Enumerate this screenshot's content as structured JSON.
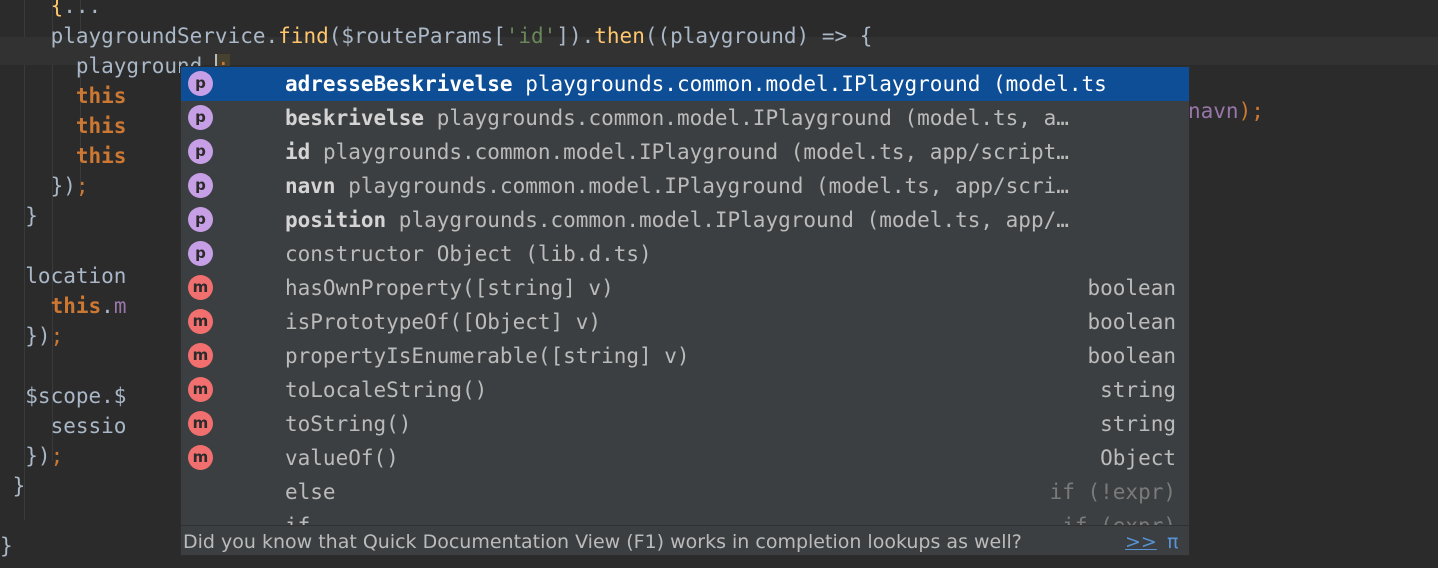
{
  "editor": {
    "lines": [
      [
        [
          "t",
          "    "
        ],
        [
          "fn",
          "{"
        ],
        [
          "t",
          "..."
        ]
      ],
      [
        [
          "t",
          "    playgroundService."
        ],
        [
          "fn",
          "find"
        ],
        [
          "t",
          "($routeParams["
        ],
        [
          "str",
          "'id'"
        ],
        [
          "t",
          "])."
        ],
        [
          "fn",
          "then"
        ],
        [
          "t",
          "((playground) => {"
        ]
      ],
      [
        [
          "t",
          "      playground."
        ]
      ],
      [
        [
          "kw",
          "      this"
        ]
      ],
      [
        [
          "kw",
          "      this"
        ]
      ],
      [
        [
          "kw",
          "      this"
        ]
      ],
      [
        [
          "t",
          "    })"
        ],
        [
          "punc",
          ";"
        ]
      ],
      [
        [
          "t",
          "  }"
        ]
      ],
      [
        [
          "t",
          ""
        ]
      ],
      [
        [
          "t",
          "  location"
        ]
      ],
      [
        [
          "kw",
          "    this"
        ],
        [
          "t",
          "."
        ],
        [
          "prop",
          "m"
        ]
      ],
      [
        [
          "t",
          "  })"
        ],
        [
          "punc",
          ";"
        ]
      ],
      [
        [
          "t",
          ""
        ]
      ],
      [
        [
          "t",
          "  $scope.$"
        ]
      ],
      [
        [
          "t",
          "    sessio"
        ]
      ],
      [
        [
          "t",
          "  })"
        ],
        [
          "punc",
          ";"
        ]
      ],
      [
        [
          "t",
          " }"
        ]
      ],
      [
        [
          "t",
          ""
        ]
      ],
      [
        [
          "t",
          "}"
        ]
      ]
    ],
    "cursor_char": ";",
    "hidden_right_text": "navn",
    "hidden_right_punct": ");"
  },
  "completion": {
    "items": [
      {
        "badge": "p",
        "name": "adresseBeskrivelse",
        "detail": " playgrounds.common.model.IPlayground (model.ts",
        "type": "",
        "bold": true,
        "selected": true
      },
      {
        "badge": "p",
        "name": "beskrivelse",
        "detail": " playgrounds.common.model.IPlayground (model.ts, a…",
        "type": "",
        "bold": true,
        "selected": false
      },
      {
        "badge": "p",
        "name": "id",
        "detail": " playgrounds.common.model.IPlayground (model.ts, app/script…",
        "type": "",
        "bold": true,
        "selected": false
      },
      {
        "badge": "p",
        "name": "navn",
        "detail": " playgrounds.common.model.IPlayground (model.ts, app/scri…",
        "type": "",
        "bold": true,
        "selected": false
      },
      {
        "badge": "p",
        "name": "position",
        "detail": " playgrounds.common.model.IPlayground (model.ts, app/…",
        "type": "",
        "bold": true,
        "selected": false
      },
      {
        "badge": "p",
        "name": "constructor",
        "detail": " Object (lib.d.ts)",
        "type": "",
        "bold": false,
        "selected": false
      },
      {
        "badge": "m",
        "name": "hasOwnProperty([string] v)",
        "detail": "",
        "type": "boolean",
        "bold": false,
        "selected": false
      },
      {
        "badge": "m",
        "name": "isPrototypeOf([Object] v)",
        "detail": "",
        "type": "boolean",
        "bold": false,
        "selected": false
      },
      {
        "badge": "m",
        "name": "propertyIsEnumerable([string] v)",
        "detail": "",
        "type": "boolean",
        "bold": false,
        "selected": false
      },
      {
        "badge": "m",
        "name": "toLocaleString()",
        "detail": "",
        "type": "string",
        "bold": false,
        "selected": false
      },
      {
        "badge": "m",
        "name": "toString()",
        "detail": "",
        "type": "string",
        "bold": false,
        "selected": false
      },
      {
        "badge": "m",
        "name": "valueOf()",
        "detail": "",
        "type": "Object",
        "bold": false,
        "selected": false
      },
      {
        "badge": "",
        "name": "else",
        "detail": "",
        "type": "if (!expr)",
        "bold": false,
        "selected": false,
        "dim": true
      },
      {
        "badge": "",
        "name": "if",
        "detail": "",
        "type": "if (expr)",
        "bold": false,
        "selected": false,
        "dim": true
      }
    ],
    "footer_tip": "Did you know that Quick Documentation View (F1) works in completion lookups as well?",
    "footer_link": ">>",
    "footer_pi": "π"
  }
}
